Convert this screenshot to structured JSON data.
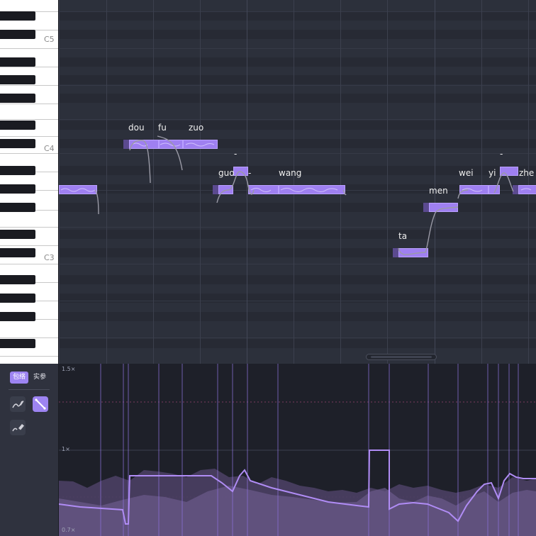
{
  "piano": {
    "octave_labels": [
      "C5",
      "C4",
      "C3"
    ]
  },
  "notes": [
    {
      "lyric": ""
    },
    {
      "lyric": "dou"
    },
    {
      "lyric": "fu"
    },
    {
      "lyric": "zuo"
    },
    {
      "lyric": "guo"
    },
    {
      "lyric": "-"
    },
    {
      "lyric": "-"
    },
    {
      "lyric": "wang"
    },
    {
      "lyric": "ta"
    },
    {
      "lyric": "men"
    },
    {
      "lyric": "wei"
    },
    {
      "lyric": "yi"
    },
    {
      "lyric": "-"
    },
    {
      "lyric": "zhe"
    }
  ],
  "tool_panel": {
    "tab_envelope": "包络",
    "tab_real_param": "实参",
    "tools": [
      "pencil-curve-icon",
      "line-tool-icon",
      "eraser-icon"
    ]
  },
  "param_panel": {
    "y_labels": [
      "1.5×",
      "1×",
      "0.7×"
    ]
  },
  "colors": {
    "note_fill": "#9f80f1",
    "note_border": "#b9a0ff",
    "curve": "#b08cf5",
    "area": "#5a4a7a",
    "grid_bg": "#2c303b",
    "panel_bg": "#1e2029"
  }
}
